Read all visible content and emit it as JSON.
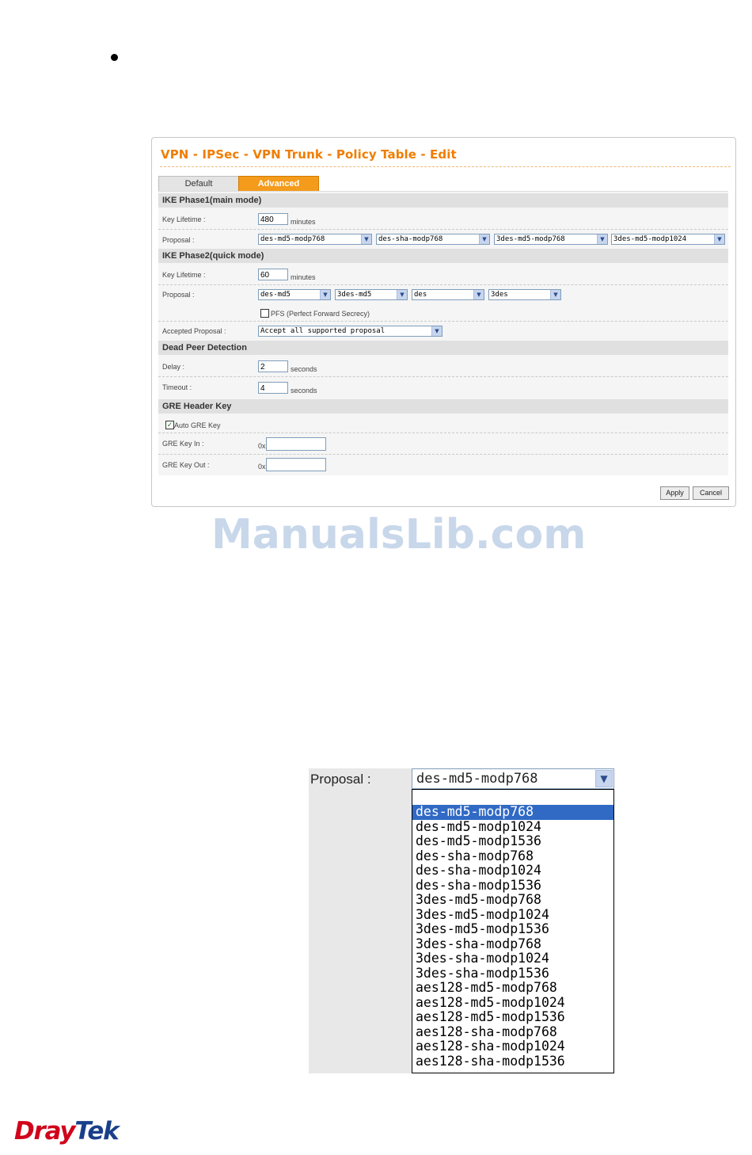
{
  "page_title": "VPN - IPSec - VPN Trunk - Policy Table - Edit",
  "tabs": [
    {
      "label": "Default"
    },
    {
      "label": "Advanced"
    }
  ],
  "ike_phase1": {
    "heading": "IKE Phase1(main mode)",
    "key_lifetime_label": "Key Lifetime :",
    "key_lifetime_value": "480",
    "key_lifetime_unit": "minutes",
    "proposal_label": "Proposal :",
    "proposals": [
      "des-md5-modp768",
      "des-sha-modp768",
      "3des-md5-modp768",
      "3des-md5-modp1024"
    ]
  },
  "ike_phase2": {
    "heading": "IKE Phase2(quick mode)",
    "key_lifetime_label": "Key Lifetime :",
    "key_lifetime_value": "60",
    "key_lifetime_unit": "minutes",
    "proposal_label": "Proposal :",
    "proposals": [
      "des-md5",
      "3des-md5",
      "des",
      "3des"
    ],
    "pfs_label": "PFS (Perfect Forward Secrecy)",
    "accepted_label": "Accepted Proposal :",
    "accepted_value": "Accept all supported proposal"
  },
  "dpd": {
    "heading": "Dead Peer Detection",
    "delay_label": "Delay :",
    "delay_value": "2",
    "delay_unit": "seconds",
    "timeout_label": "Timeout :",
    "timeout_value": "4",
    "timeout_unit": "seconds"
  },
  "gre": {
    "heading": "GRE Header Key",
    "auto_label": "Auto GRE Key",
    "auto_checked": true,
    "key_in_label": "GRE Key In :",
    "key_out_label": "GRE Key Out :",
    "prefix": "0x",
    "key_in_value": "",
    "key_out_value": ""
  },
  "buttons": {
    "apply": "Apply",
    "cancel": "Cancel"
  },
  "watermark": "ManualsLib.com",
  "zoom_dropdown": {
    "label": "Proposal :",
    "selected": "des-md5-modp768",
    "options": [
      "des-md5-modp768",
      "des-md5-modp1024",
      "des-md5-modp1536",
      "des-sha-modp768",
      "des-sha-modp1024",
      "des-sha-modp1536",
      "3des-md5-modp768",
      "3des-md5-modp1024",
      "3des-md5-modp1536",
      "3des-sha-modp768",
      "3des-sha-modp1024",
      "3des-sha-modp1536",
      "aes128-md5-modp768",
      "aes128-md5-modp1024",
      "aes128-md5-modp1536",
      "aes128-sha-modp768",
      "aes128-sha-modp1024",
      "aes128-sha-modp1536"
    ]
  },
  "logo": {
    "part1": "Dray",
    "part2": "Tek"
  },
  "colors": {
    "accent": "#f07d00",
    "tab_active": "#f49b1b",
    "highlight": "#316ac5",
    "logo_red": "#d0021b",
    "logo_blue": "#1a3f8a"
  }
}
